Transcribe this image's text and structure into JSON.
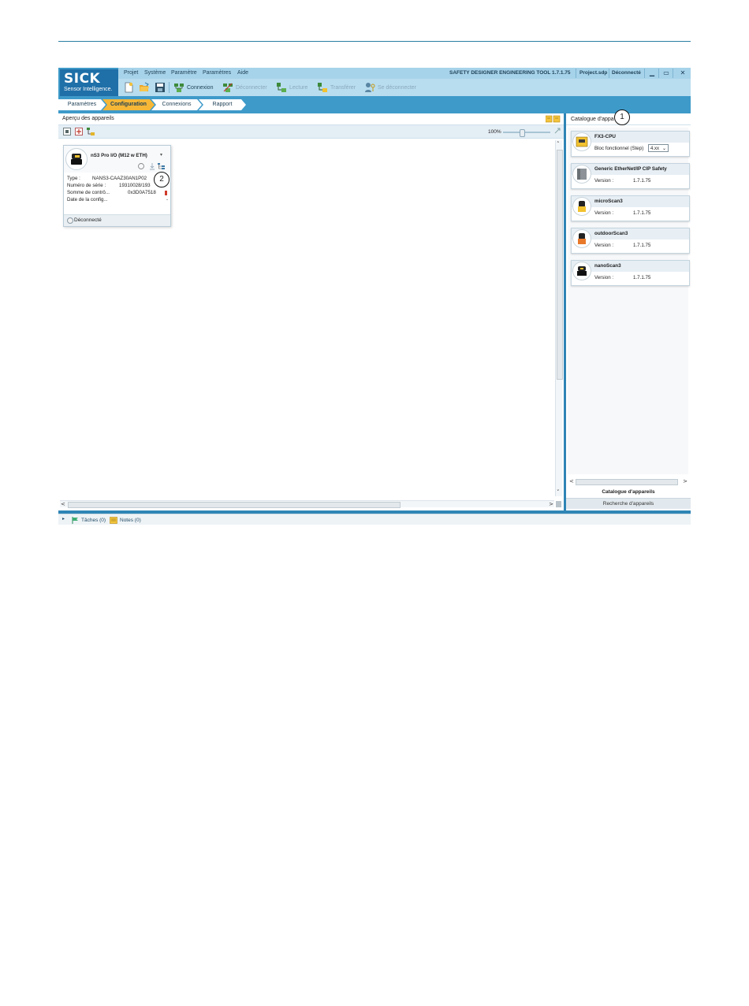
{
  "app": {
    "logo_main": "SICK",
    "logo_tagline": "Sensor Intelligence."
  },
  "menu": {
    "items": [
      "Projet",
      "Système",
      "Paramètre",
      "Paramètres",
      "Aide"
    ],
    "app_title": "SAFETY DESIGNER ENGINEERING TOOL 1.7.1.75",
    "project_file": "Project.sdp",
    "connection_state": "Déconnecté"
  },
  "toolbar": {
    "connect": "Connexion",
    "disconnect": "Déconnecter",
    "read": "Lecture",
    "transfer": "Transférer",
    "self_disconnect": "Se déconnecter"
  },
  "tabs": [
    {
      "label": "Paramètres",
      "active": false
    },
    {
      "label": "Configuration",
      "active": true
    },
    {
      "label": "Connexions",
      "active": false
    },
    {
      "label": "Rapport",
      "active": false
    }
  ],
  "left_panel": {
    "title": "Aperçu des appareils",
    "zoom": "100%",
    "zoom_level_percent": 40
  },
  "device_card": {
    "title": "nS3 Pro I/O (M12 w ETH)",
    "rows": [
      {
        "key": "Type :",
        "value": "NANS3-CAAZ30AN1P02"
      },
      {
        "key": "Numéro de série :",
        "value": "19310028/193"
      },
      {
        "key": "Somme de contrô...",
        "value": "0x3D0A7518"
      },
      {
        "key": "Date de la config...",
        "value": "-"
      }
    ],
    "status": "Déconnecté"
  },
  "callouts": {
    "one": "1",
    "two": "2"
  },
  "right_panel": {
    "title": "Catalogue d'appa",
    "items": [
      {
        "name": "FX3-CPU",
        "label": "Bloc fonctionnel (Step)",
        "select": "4.xx"
      },
      {
        "name": "Generic EtherNet/IP CIP Safety",
        "label": "Version :",
        "value": "1.7.1.75"
      },
      {
        "name": "microScan3",
        "label": "Version :",
        "value": "1.7.1.75"
      },
      {
        "name": "outdoorScan3",
        "label": "Version :",
        "value": "1.7.1.75"
      },
      {
        "name": "nanoScan3",
        "label": "Version :",
        "value": "1.7.1.75"
      }
    ],
    "tab_catalog": "Catalogue d'appareils",
    "tab_search": "Recherche d'appareils"
  },
  "status_bar": {
    "tasks": "Tâches (0)",
    "notes": "Notes (0)"
  },
  "colors": {
    "header_blue": "#3e9ac9",
    "menubar": "#a7d3ea",
    "active_tab": "#f6b737",
    "divider": "#2f85b5"
  }
}
